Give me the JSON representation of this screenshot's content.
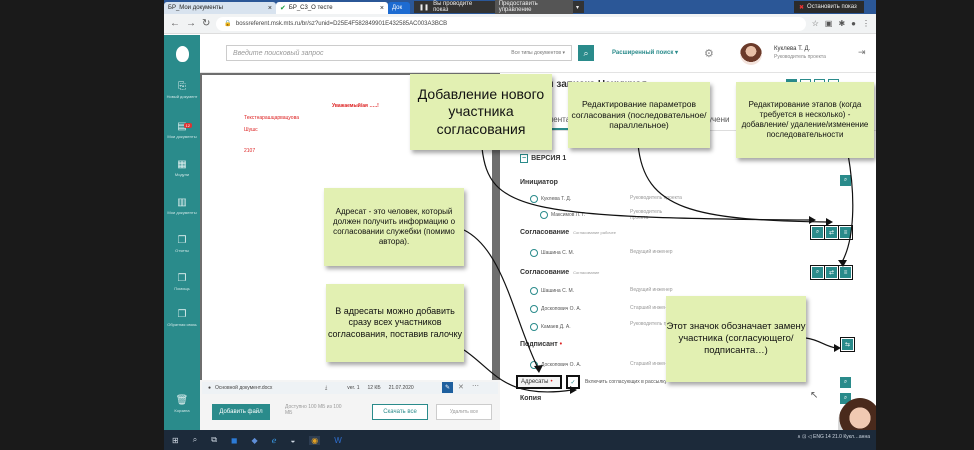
{
  "browser": {
    "tabs": [
      {
        "label": "БР_Мои документы",
        "active": false
      },
      {
        "label": "БР_С3_О тесте",
        "active": true
      },
      {
        "label": "Док",
        "active": false
      }
    ],
    "share_text": "Вы проводите показ",
    "share_control": "Предоставить управление",
    "stop_share": "Остановить показ",
    "url": "bossreferent.msk.mts.ru/br/sz?unid=D25E4F582849901E432585AC003A3BCB"
  },
  "header": {
    "search_placeholder": "Введите поисковый запрос",
    "doc_types": "Все типы документов",
    "advanced_search": "Расширенный поиск",
    "user_name": "Куклева Т. Д.",
    "user_role": "Руководитель проекта"
  },
  "sidebar": {
    "items": [
      {
        "label": "Новый документ",
        "icon": "new-doc-icon"
      },
      {
        "label": "Мои документы",
        "icon": "inbox-icon",
        "badge": "12"
      },
      {
        "label": "Модули",
        "icon": "modules-icon"
      },
      {
        "label": "Мои документы",
        "icon": "documents-icon"
      },
      {
        "label": "Отчеты",
        "icon": "reports-icon"
      },
      {
        "label": "Помощь",
        "icon": "help-icon"
      },
      {
        "label": "Обратная связь",
        "icon": "feedback-icon"
      },
      {
        "label": "Корзина",
        "icon": "trash-icon"
      }
    ]
  },
  "document": {
    "heading": "Уважаемый/ая …..!",
    "body_line1": "Текстнарашцарвацуова",
    "body_line2": "Шушс",
    "body_line3": "2107",
    "file_name": "Основной документ.docx",
    "file_version": "ver. 1",
    "file_size": "12 КБ",
    "file_date": "21.07.2020",
    "add_file": "Добавить файл",
    "limit": "Доступно 100 МБ из 100 МБ",
    "download_all": "Скачать все",
    "delete_all": "Удалить все"
  },
  "panel": {
    "title": "…бная записка Ненужная",
    "tab_route": "ие документа",
    "tab_links": "…учени",
    "version": "ВЕРСИЯ 1",
    "initiator_title": "Инициатор",
    "initiators": [
      {
        "name": "Куклева Т. Д.",
        "role": "Руководитель проекта"
      },
      {
        "name": "Максимов Л. Г.",
        "role": "Руководитель проекта"
      }
    ],
    "approval1_title": "Согласование",
    "approval1_sub": "Согласование рабочее",
    "approval1_people": [
      {
        "name": "Шашина С. М.",
        "role": "Ведущий инженер"
      }
    ],
    "approval2_title": "Согласование",
    "approval2_sub": "Согласование",
    "approval2_people": [
      {
        "name": "Шашина С. М.",
        "role": "Ведущий инженер"
      },
      {
        "name": "Доскопович О. А.",
        "role": "Старший инженер"
      },
      {
        "name": "Камаев Д. А.",
        "role": "Руководитель группы"
      }
    ],
    "signer_title": "Подписант",
    "signers": [
      {
        "name": "Доскопович О. А.",
        "role": "Старший инженер"
      }
    ],
    "addressees": "Адресаты",
    "include_text": "Включить согласующих в рассылку",
    "copy": "Копия"
  },
  "notes": {
    "add_participant": "Добавление нового участника согласования",
    "edit_params": "Редактирование параметров согласования (последовательное/ параллельное)",
    "edit_stages": "Редактирование этапов (когда требуется в несколько) - добавление/ удаление/изменение последовательности",
    "addressee_info": "Адресат - это человек, который должен получить информацию о согласовании служебки (помимо автора).",
    "add_all": "В адресаты можно добавить сразу всех участников согласования, поставив галочку",
    "replace_icon": "Этот значок обозначает замену участника (согласующего/ подписанта…)"
  },
  "taskbar": {
    "lang": "ENG",
    "time": "14",
    "date": "21.0",
    "webcam_label": "Кукл…анна"
  },
  "colors": {
    "accent": "#2a8b8b",
    "note": "#e2f0b2",
    "doc_red": "#dd2222"
  }
}
